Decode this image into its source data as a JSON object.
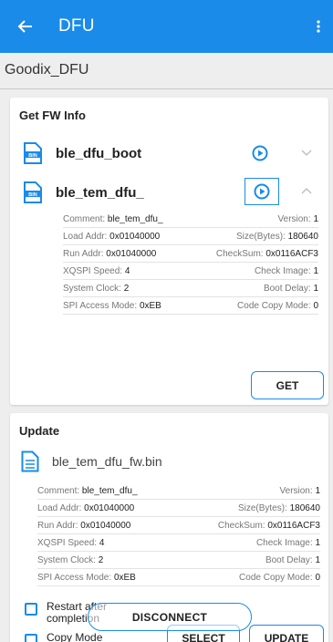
{
  "appbar": {
    "title": "DFU"
  },
  "subtitle": "Goodix_DFU",
  "fw_card": {
    "title": "Get FW Info",
    "items": [
      {
        "name": "ble_dfu_boot",
        "icon_text": "BIN"
      },
      {
        "name": "ble_tem_dfu_",
        "icon_text": "BIN"
      }
    ],
    "info": [
      {
        "l_label": "Comment:",
        "l_value": "ble_tem_dfu_",
        "r_label": "Version:",
        "r_value": "1"
      },
      {
        "l_label": "Load Addr:",
        "l_value": "0x01040000",
        "r_label": "Size(Bytes):",
        "r_value": "180640"
      },
      {
        "l_label": "Run Addr:",
        "l_value": "0x01040000",
        "r_label": "CheckSum:",
        "r_value": "0x0116ACF3"
      },
      {
        "l_label": "XQSPI Speed:",
        "l_value": "4",
        "r_label": "Check Image:",
        "r_value": "1"
      },
      {
        "l_label": "System Clock:",
        "l_value": "2",
        "r_label": "Boot Delay:",
        "r_value": "1"
      },
      {
        "l_label": "SPI Access Mode:",
        "l_value": "0xEB",
        "r_label": "Code Copy Mode:",
        "r_value": "0"
      }
    ],
    "get_label": "GET"
  },
  "update_card": {
    "title": "Update",
    "file_name": "ble_tem_dfu_fw.bin",
    "info": [
      {
        "l_label": "Comment:",
        "l_value": "ble_tem_dfu_",
        "r_label": "Version:",
        "r_value": "1"
      },
      {
        "l_label": "Load Addr:",
        "l_value": "0x01040000",
        "r_label": "Size(Bytes):",
        "r_value": "180640"
      },
      {
        "l_label": "Run Addr:",
        "l_value": "0x01040000",
        "r_label": "CheckSum:",
        "r_value": "0x0116ACF3"
      },
      {
        "l_label": "XQSPI Speed:",
        "l_value": "4",
        "r_label": "Check Image:",
        "r_value": "1"
      },
      {
        "l_label": "System Clock:",
        "l_value": "2",
        "r_label": "Boot Delay:",
        "r_value": "1"
      },
      {
        "l_label": "SPI Access Mode:",
        "l_value": "0xEB",
        "r_label": "Code Copy Mode:",
        "r_value": "0"
      }
    ],
    "restart_label_1": "Restart after",
    "restart_label_2": "completion",
    "copy_mode_label": "Copy Mode",
    "select_label": "SELECT",
    "update_label": "UPDATE"
  },
  "disconnect_label": "DISCONNECT",
  "colors": {
    "primary": "#1a8be8",
    "background": "#eeeeee",
    "card": "#ffffff"
  },
  "icons": [
    "back-arrow-icon",
    "more-vert-icon",
    "bin-file-icon",
    "play-circle-icon",
    "chevron-down-icon",
    "chevron-up-icon",
    "document-icon",
    "checkbox-icon"
  ]
}
